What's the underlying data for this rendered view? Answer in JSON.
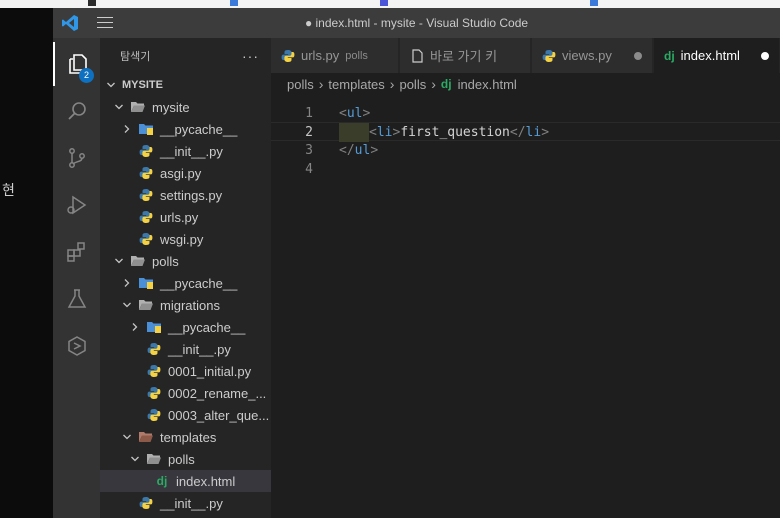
{
  "background": {
    "left_text": "현"
  },
  "titlebar": {
    "title": "● index.html - mysite - Visual Studio Code"
  },
  "activity_bar": {
    "explorer_badge": "2"
  },
  "sidebar": {
    "title": "탐색기",
    "more_label": "···",
    "tree": [
      {
        "label": "MYSITE",
        "type": "root",
        "depth": 0,
        "expanded": true
      },
      {
        "label": "mysite",
        "type": "folder",
        "depth": 1,
        "expanded": true
      },
      {
        "label": "__pycache__",
        "type": "folder-special",
        "depth": 2,
        "expanded": false
      },
      {
        "label": "__init__.py",
        "type": "python",
        "depth": 2
      },
      {
        "label": "asgi.py",
        "type": "python",
        "depth": 2
      },
      {
        "label": "settings.py",
        "type": "python",
        "depth": 2
      },
      {
        "label": "urls.py",
        "type": "python",
        "depth": 2
      },
      {
        "label": "wsgi.py",
        "type": "python",
        "depth": 2
      },
      {
        "label": "polls",
        "type": "folder",
        "depth": 1,
        "expanded": true
      },
      {
        "label": "__pycache__",
        "type": "folder-special",
        "depth": 2,
        "expanded": false
      },
      {
        "label": "migrations",
        "type": "folder",
        "depth": 2,
        "expanded": true
      },
      {
        "label": "__pycache__",
        "type": "folder-special",
        "depth": 3,
        "expanded": false
      },
      {
        "label": "__init__.py",
        "type": "python",
        "depth": 3
      },
      {
        "label": "0001_initial.py",
        "type": "python",
        "depth": 3
      },
      {
        "label": "0002_rename_...",
        "type": "python",
        "depth": 3
      },
      {
        "label": "0003_alter_que...",
        "type": "python",
        "depth": 3
      },
      {
        "label": "templates",
        "type": "folder-templates",
        "depth": 2,
        "expanded": true
      },
      {
        "label": "polls",
        "type": "folder",
        "depth": 3,
        "expanded": true
      },
      {
        "label": "index.html",
        "type": "django",
        "depth": 4,
        "selected": true
      },
      {
        "label": "__init__.py",
        "type": "python",
        "depth": 2
      }
    ]
  },
  "tabs": [
    {
      "label": "urls.py",
      "description": "polls",
      "icon": "python-icon",
      "active": false,
      "dirty": false
    },
    {
      "label": "바로 가기 키",
      "description": "",
      "icon": "file-icon",
      "active": false,
      "dirty": false
    },
    {
      "label": "views.py",
      "description": "",
      "icon": "python-icon",
      "active": false,
      "dirty": true
    },
    {
      "label": "index.html",
      "description": "",
      "icon": "django-icon",
      "active": true,
      "dirty": true
    }
  ],
  "breadcrumb": {
    "items": [
      "polls",
      "templates",
      "polls"
    ],
    "file_icon": "dj",
    "file": "index.html"
  },
  "editor": {
    "lines": [
      {
        "number": "1",
        "open": "<",
        "tag": "ul",
        "close": ">",
        "text": "",
        "etag_open": "",
        "etag": "",
        "etag_close": ""
      },
      {
        "number": "2",
        "open": "<",
        "tag": "li",
        "close": ">",
        "text": "first_question",
        "etag_open": "</",
        "etag": "li",
        "etag_close": ">"
      },
      {
        "number": "3",
        "open": "</",
        "tag": "ul",
        "close": ">",
        "text": "",
        "etag_open": "",
        "etag": "",
        "etag_close": ""
      },
      {
        "number": "4",
        "open": "",
        "tag": "",
        "close": "",
        "text": "",
        "etag_open": "",
        "etag": "",
        "etag_close": ""
      }
    ],
    "current_line": "2"
  },
  "colors": {
    "tag": "#569cd6",
    "bracket": "#808080",
    "text": "#d4d4d4",
    "django_icon": "#2bab63",
    "badge": "#0e70c0"
  }
}
